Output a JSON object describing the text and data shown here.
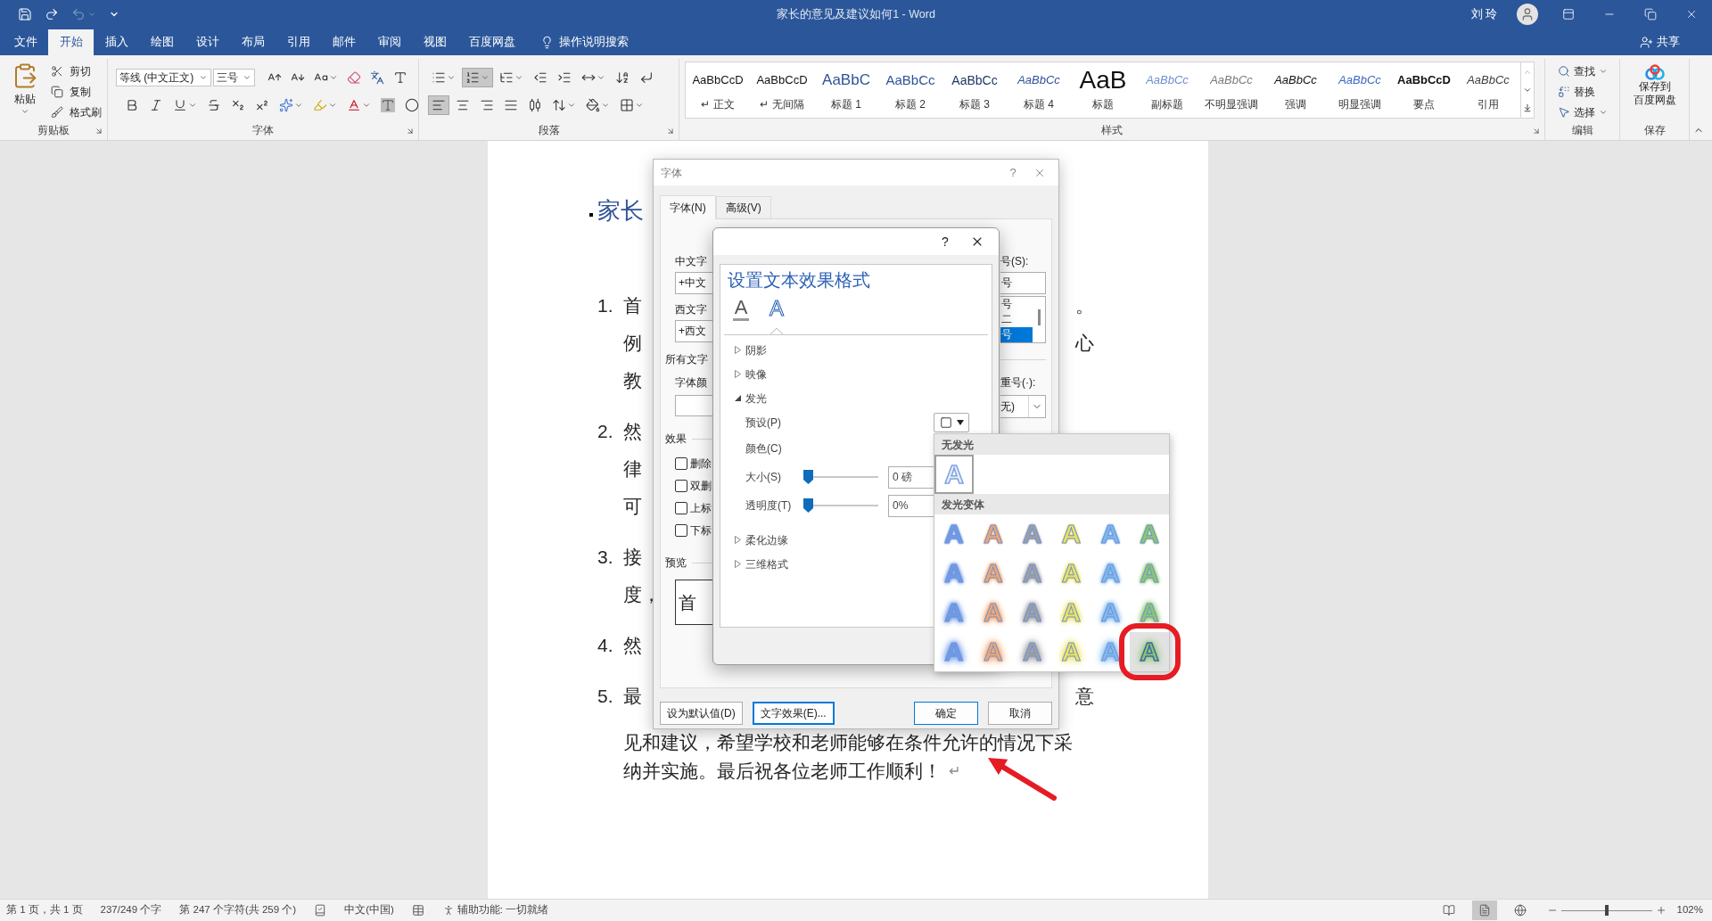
{
  "title_bar": {
    "quick_access": [
      {
        "kind": "save",
        "disabled": false
      },
      {
        "kind": "redo",
        "disabled": false
      },
      {
        "kind": "undo",
        "disabled": true
      }
    ],
    "title": "家长的意见及建议如何1 - Word",
    "user": "刘 玲"
  },
  "menu_tabs": [
    {
      "label": "文件",
      "selected": false
    },
    {
      "label": "开始",
      "selected": true
    },
    {
      "label": "插入",
      "selected": false
    },
    {
      "label": "绘图",
      "selected": false
    },
    {
      "label": "设计",
      "selected": false
    },
    {
      "label": "布局",
      "selected": false
    },
    {
      "label": "引用",
      "selected": false
    },
    {
      "label": "邮件",
      "selected": false
    },
    {
      "label": "审阅",
      "selected": false
    },
    {
      "label": "视图",
      "selected": false
    },
    {
      "label": "百度网盘",
      "selected": false
    }
  ],
  "tell_me": "操作说明搜索",
  "share": "共享",
  "ribbon": {
    "clipboard": {
      "label": "剪贴板",
      "paste": "粘贴",
      "commands": [
        {
          "kind": "cut",
          "label": "剪切"
        },
        {
          "kind": "copy",
          "label": "复制"
        },
        {
          "kind": "format_painter",
          "label": "格式刷"
        }
      ]
    },
    "font": {
      "label": "字体",
      "font_name": "等线 (中文正文)",
      "font_size": "三号",
      "row1": [
        {
          "kind": "grow"
        },
        {
          "kind": "shrink"
        },
        {
          "kind": "change_case"
        },
        {
          "kind": "clear"
        },
        {
          "kind": "phonetic"
        },
        {
          "kind": "border"
        }
      ],
      "row2": [
        {
          "kind": "bold"
        },
        {
          "kind": "italic"
        },
        {
          "kind": "underline"
        },
        {
          "kind": "strikethrough"
        },
        {
          "kind": "subscript"
        },
        {
          "kind": "superscript"
        },
        {
          "kind": "effects"
        },
        {
          "kind": "highlight"
        },
        {
          "kind": "color"
        },
        {
          "kind": "shading"
        },
        {
          "kind": "enclosed"
        }
      ]
    },
    "paragraph": {
      "label": "段落",
      "row1": [
        {
          "kind": "bullets",
          "selected": false
        },
        {
          "kind": "numbering",
          "selected": true
        },
        {
          "kind": "multilevel",
          "selected": false
        },
        {
          "kind": "outdent",
          "selected": false
        },
        {
          "kind": "indent",
          "selected": false
        },
        {
          "kind": "asian_layout",
          "selected": false
        },
        {
          "kind": "sort",
          "selected": false
        },
        {
          "kind": "marks",
          "selected": false
        }
      ],
      "row2": [
        {
          "kind": "align_left",
          "selected": true
        },
        {
          "kind": "align_center",
          "selected": false
        },
        {
          "kind": "align_right",
          "selected": false
        },
        {
          "kind": "justify",
          "selected": false
        },
        {
          "kind": "distributed",
          "selected": false
        },
        {
          "kind": "line_spacing",
          "selected": false
        },
        {
          "kind": "shading",
          "selected": false
        },
        {
          "kind": "borders",
          "selected": false
        }
      ]
    },
    "styles": {
      "label": "样式",
      "items": [
        {
          "kind": "normal",
          "preview": "AaBbCcD",
          "name": "↵ 正文"
        },
        {
          "kind": "no_spacing",
          "preview": "AaBbCcD",
          "name": "↵ 无间隔"
        },
        {
          "kind": "heading1",
          "preview": "AaBbC",
          "name": "标题 1"
        },
        {
          "kind": "heading2",
          "preview": "AaBbCc",
          "name": "标题 2"
        },
        {
          "kind": "heading3",
          "preview": "AaBbCc",
          "name": "标题 3"
        },
        {
          "kind": "heading4",
          "preview": "AaBbCc",
          "name": "标题 4"
        },
        {
          "kind": "title",
          "preview": "AaB",
          "name": "标题"
        },
        {
          "kind": "subtitle",
          "preview": "AaBbCc",
          "name": "副标题"
        },
        {
          "kind": "subtle_emphasis",
          "preview": "AaBbCc",
          "name": "不明显强调"
        },
        {
          "kind": "emphasis",
          "preview": "AaBbCc",
          "name": "强调"
        },
        {
          "kind": "intense_emphasis",
          "preview": "AaBbCc",
          "name": "明显强调"
        },
        {
          "kind": "strong",
          "preview": "AaBbCcD",
          "name": "要点"
        },
        {
          "kind": "quote",
          "preview": "AaBbCc",
          "name": "引用"
        }
      ]
    },
    "editing": {
      "label": "编辑",
      "commands": [
        {
          "kind": "find",
          "label": "查找"
        },
        {
          "kind": "replace",
          "label": "替换"
        },
        {
          "kind": "select",
          "label": "选择"
        }
      ]
    },
    "save": {
      "label": "保存",
      "lines": [
        "保存到",
        "百度网盘"
      ]
    }
  },
  "document": {
    "heading": "家长",
    "paragraphs": [
      {
        "number": "1.",
        "lines": [
          {
            "left": "首",
            "right": "。"
          },
          {
            "left": "例",
            "right": "心"
          },
          {
            "left": "教"
          }
        ]
      },
      {
        "number": "2.",
        "lines": [
          {
            "left": "然"
          },
          {
            "left": "律"
          },
          {
            "left": "可"
          }
        ]
      },
      {
        "number": "3.",
        "lines": [
          {
            "left": "接"
          },
          {
            "left": "度，"
          }
        ]
      },
      {
        "number": "4.",
        "lines": [
          {
            "left": "然"
          }
        ]
      },
      {
        "number": "5.",
        "lines": [
          {
            "left": "最",
            "right": "意"
          },
          {
            "left": "见和建议，希望学校和老师能够在条件允许的情况下采"
          },
          {
            "left": "纳并实施。最后祝各位老师工作顺利！",
            "mark": "↵"
          }
        ]
      }
    ]
  },
  "font_dialog": {
    "title": "字体",
    "help": "?",
    "tabs": [
      {
        "label": "字体(N)",
        "selected": true
      },
      {
        "label": "高级(V)",
        "selected": false
      }
    ],
    "name_fields": [
      {
        "label": "中文字",
        "value": "+中文"
      },
      {
        "label": "西文字",
        "value": "+西文"
      }
    ],
    "all_text": "所有文字",
    "color_label": "字体颜",
    "effects_label": "效果",
    "effects": [
      {
        "label": "删除",
        "checked": false
      },
      {
        "label": "双删",
        "checked": false
      },
      {
        "label": "上标",
        "checked": false
      },
      {
        "label": "下标",
        "checked": false
      }
    ],
    "preview_label": "预览",
    "preview": "首",
    "size_label": "号(S):",
    "size_value": "号",
    "size_options": [
      {
        "label": "号",
        "selected": false
      },
      {
        "label": "二",
        "selected": false
      },
      {
        "label": "号",
        "selected": true
      }
    ],
    "emphasis_label": "重号(·):",
    "emphasis_value": "无)",
    "buttons": [
      {
        "kind": "plain",
        "label": "设为默认值(D)"
      },
      {
        "kind": "focused",
        "label": "文字效果(E)..."
      },
      {
        "kind": "primary",
        "label": "确定"
      },
      {
        "kind": "plain",
        "label": "取消"
      }
    ]
  },
  "text_effects_dialog": {
    "help": "?",
    "title": "设置文本效果格式",
    "icon_tabs": [
      {
        "kind": "fill",
        "glyph": "A",
        "selected": false
      },
      {
        "kind": "effects",
        "glyph": "A",
        "selected": true
      }
    ],
    "sections": [
      {
        "label": "阴影",
        "expanded": false
      },
      {
        "label": "映像",
        "expanded": false
      },
      {
        "label": "发光",
        "expanded": true,
        "rows": [
          {
            "kind": "preset",
            "label": "预设(P)"
          },
          {
            "kind": "color",
            "label": "颜色(C)"
          },
          {
            "kind": "slider",
            "label": "大小(S)",
            "level": 0,
            "value": "0 磅"
          },
          {
            "kind": "slider",
            "label": "透明度(T)",
            "level": 0,
            "value": "0%"
          }
        ]
      },
      {
        "label": "柔化边缘",
        "expanded": false
      },
      {
        "label": "三维格式",
        "expanded": false
      }
    ]
  },
  "glow_gallery": {
    "no_glow_label": "无发光",
    "no_glow": {
      "glyph": "A",
      "selected": true
    },
    "variants_label": "发光变体",
    "rows": [
      {
        "cells": [
          {
            "glyph": "A",
            "color": "#6f9be8",
            "highlighted": false
          },
          {
            "glyph": "A",
            "color": "#f4a56b",
            "highlighted": false
          },
          {
            "glyph": "A",
            "color": "#a0a0a0",
            "highlighted": false
          },
          {
            "glyph": "A",
            "color": "#ede35a",
            "highlighted": false
          },
          {
            "glyph": "A",
            "color": "#7fb8f0",
            "highlighted": false
          },
          {
            "glyph": "A",
            "color": "#8cc86a",
            "highlighted": false
          }
        ]
      },
      {
        "cells": [
          {
            "glyph": "A",
            "color": "#6f9be8",
            "highlighted": false
          },
          {
            "glyph": "A",
            "color": "#f4a56b",
            "highlighted": false
          },
          {
            "glyph": "A",
            "color": "#a0a0a0",
            "highlighted": false
          },
          {
            "glyph": "A",
            "color": "#ede35a",
            "highlighted": false
          },
          {
            "glyph": "A",
            "color": "#7fb8f0",
            "highlighted": false
          },
          {
            "glyph": "A",
            "color": "#8cc86a",
            "highlighted": false
          }
        ]
      },
      {
        "cells": [
          {
            "glyph": "A",
            "color": "#6f9be8",
            "highlighted": false
          },
          {
            "glyph": "A",
            "color": "#f4a56b",
            "highlighted": false
          },
          {
            "glyph": "A",
            "color": "#a0a0a0",
            "highlighted": false
          },
          {
            "glyph": "A",
            "color": "#ede35a",
            "highlighted": false
          },
          {
            "glyph": "A",
            "color": "#7fb8f0",
            "highlighted": false
          },
          {
            "glyph": "A",
            "color": "#8cc86a",
            "highlighted": false
          }
        ]
      },
      {
        "cells": [
          {
            "glyph": "A",
            "color": "#6f9be8",
            "highlighted": false
          },
          {
            "glyph": "A",
            "color": "#f4a56b",
            "highlighted": false
          },
          {
            "glyph": "A",
            "color": "#a0a0a0",
            "highlighted": false
          },
          {
            "glyph": "A",
            "color": "#ede35a",
            "highlighted": false
          },
          {
            "glyph": "A",
            "color": "#7fb8f0",
            "highlighted": false
          },
          {
            "glyph": "A",
            "color": "#8cc86a",
            "highlighted": true
          }
        ]
      }
    ]
  },
  "status_bar": {
    "items": [
      {
        "kind": "pages",
        "label": "第 1 页，共 1 页"
      },
      {
        "kind": "words",
        "label": "237/249 个字"
      },
      {
        "kind": "characters",
        "label": "第 247 个字符(共 259 个)"
      },
      {
        "kind": "proofing"
      },
      {
        "kind": "language",
        "label": "中文(中国)"
      },
      {
        "kind": "macro"
      },
      {
        "kind": "accessibility",
        "label": "辅助功能: 一切就绪"
      }
    ],
    "views": [
      {
        "kind": "read",
        "selected": false
      },
      {
        "kind": "print",
        "selected": true
      },
      {
        "kind": "web",
        "selected": false
      }
    ],
    "zoom": {
      "level": 0.5,
      "label": "102%"
    }
  }
}
